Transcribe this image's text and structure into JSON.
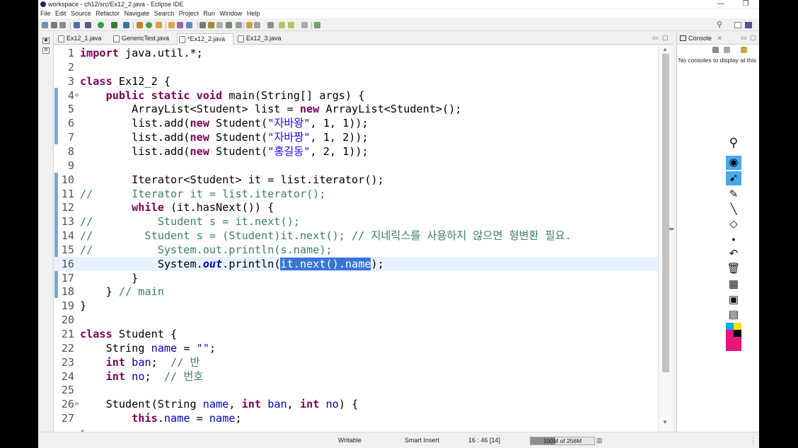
{
  "window": {
    "title": "workspace - ch12/src/Ex12_2.java - Eclipse IDE",
    "controls": [
      "—",
      "❐",
      "✕"
    ]
  },
  "menu": [
    "File",
    "Edit",
    "Source",
    "Refactor",
    "Navigate",
    "Search",
    "Project",
    "Run",
    "Window",
    "Help"
  ],
  "editor_tabs": [
    {
      "label": "Ex12_1.java",
      "active": false
    },
    {
      "label": "GenericTest.java",
      "active": false
    },
    {
      "label": "*Ex12_2.java",
      "active": true
    },
    {
      "label": "Ex12_3.java",
      "active": false
    }
  ],
  "tab_close": "✕",
  "editor_controls": {
    "minimize": "▭",
    "maximize": "▢"
  },
  "code_lines": [
    {
      "n": "1",
      "tokens": [
        [
          "kw",
          "import"
        ],
        [
          "",
          " java.util.*;"
        ]
      ]
    },
    {
      "n": "2",
      "tokens": []
    },
    {
      "n": "3",
      "tokens": [
        [
          "kw",
          "class"
        ],
        [
          "",
          " Ex12_2 {"
        ]
      ]
    },
    {
      "n": "4",
      "fold": "⊖",
      "tokens": [
        [
          "",
          "    "
        ],
        [
          "kw",
          "public static void"
        ],
        [
          "",
          " main(String[] args) {"
        ]
      ]
    },
    {
      "n": "5",
      "tokens": [
        [
          "",
          "        ArrayList<Student> list = "
        ],
        [
          "kw",
          "new"
        ],
        [
          "",
          " ArrayList<Student>();"
        ]
      ]
    },
    {
      "n": "6",
      "tokens": [
        [
          "",
          "        list.add("
        ],
        [
          "kw",
          "new"
        ],
        [
          "",
          " Student("
        ],
        [
          "str",
          "\"자바왕\""
        ],
        [
          "",
          ", 1, 1));"
        ]
      ]
    },
    {
      "n": "7",
      "tokens": [
        [
          "",
          "        list.add("
        ],
        [
          "kw",
          "new"
        ],
        [
          "",
          " Student("
        ],
        [
          "str",
          "\"자바짱\""
        ],
        [
          "",
          ", 1, 2));"
        ]
      ]
    },
    {
      "n": "8",
      "tokens": [
        [
          "",
          "        list.add("
        ],
        [
          "kw",
          "new"
        ],
        [
          "",
          " Student("
        ],
        [
          "str",
          "\"홍길동\""
        ],
        [
          "",
          ", 2, 1));"
        ]
      ]
    },
    {
      "n": "9",
      "tokens": []
    },
    {
      "n": "10",
      "tokens": [
        [
          "",
          "        Iterator<Student> it = list.iterator();"
        ]
      ]
    },
    {
      "n": "11",
      "tokens": [
        [
          "cmt",
          "//      Iterator it = list.iterator();"
        ]
      ]
    },
    {
      "n": "12",
      "tokens": [
        [
          "",
          "        "
        ],
        [
          "kw",
          "while"
        ],
        [
          "",
          " (it.hasNext()) {"
        ]
      ]
    },
    {
      "n": "13",
      "tokens": [
        [
          "cmt",
          "//          Student s = it.next();"
        ]
      ]
    },
    {
      "n": "14",
      "tokens": [
        [
          "cmt",
          "//        Student s = (Student)it.next(); // 지네릭스를 사용하지 않으면 형변환 필요."
        ]
      ]
    },
    {
      "n": "15",
      "tokens": [
        [
          "cmt",
          "//          System.out.println(s.name);"
        ]
      ]
    },
    {
      "n": "16",
      "current": true,
      "tokens": [
        [
          "",
          "            System."
        ],
        [
          "sfld",
          "out"
        ],
        [
          "",
          ".println("
        ],
        [
          "sel",
          "it.next().name"
        ],
        [
          "",
          ");"
        ]
      ]
    },
    {
      "n": "17",
      "tokens": [
        [
          "",
          "        }"
        ]
      ]
    },
    {
      "n": "18",
      "tokens": [
        [
          "",
          "    } "
        ],
        [
          "cmt",
          "// main"
        ]
      ]
    },
    {
      "n": "19",
      "tokens": [
        [
          "",
          "}"
        ]
      ]
    },
    {
      "n": "20",
      "tokens": []
    },
    {
      "n": "21",
      "tokens": [
        [
          "kw",
          "class"
        ],
        [
          "",
          " Student {"
        ]
      ]
    },
    {
      "n": "22",
      "tokens": [
        [
          "",
          "    String "
        ],
        [
          "fld",
          "name"
        ],
        [
          "",
          " = "
        ],
        [
          "str",
          "\"\""
        ],
        [
          "",
          ";"
        ]
      ]
    },
    {
      "n": "23",
      "tokens": [
        [
          "",
          "    "
        ],
        [
          "kw",
          "int"
        ],
        [
          "",
          " "
        ],
        [
          "fld",
          "ban"
        ],
        [
          "",
          ";  "
        ],
        [
          "cmt",
          "// 반"
        ]
      ]
    },
    {
      "n": "24",
      "tokens": [
        [
          "",
          "    "
        ],
        [
          "kw",
          "int"
        ],
        [
          "",
          " "
        ],
        [
          "fld",
          "no"
        ],
        [
          "",
          ";  "
        ],
        [
          "cmt",
          "// 번호"
        ]
      ]
    },
    {
      "n": "25",
      "tokens": []
    },
    {
      "n": "26",
      "fold": "⊖",
      "tokens": [
        [
          "",
          "    Student(String "
        ],
        [
          "fld",
          "name"
        ],
        [
          "",
          ", "
        ],
        [
          "kw",
          "int"
        ],
        [
          "",
          " "
        ],
        [
          "fld",
          "ban"
        ],
        [
          "",
          ", "
        ],
        [
          "kw",
          "int"
        ],
        [
          "",
          " "
        ],
        [
          "fld",
          "no"
        ],
        [
          "",
          ") {"
        ]
      ]
    },
    {
      "n": "27",
      "tokens": [
        [
          "",
          "        "
        ],
        [
          "kw",
          "this"
        ],
        [
          "",
          "."
        ],
        [
          "fld",
          "name"
        ],
        [
          "",
          " = "
        ],
        [
          "fld",
          "name"
        ],
        [
          "",
          ";"
        ]
      ]
    }
  ],
  "console": {
    "tab_label": "Console",
    "message": "No consoles to display at this"
  },
  "status": {
    "writable": "Writable",
    "insert_mode": "Smart Insert",
    "position": "16 : 46 [14]",
    "memory": "100M of 256M",
    "memory_used_fraction": 0.39
  },
  "colors": {
    "keyword": "#7f0055",
    "string": "#2a00ff",
    "comment": "#3f7f5f",
    "field": "#0000c0",
    "selection": "#3875d7",
    "current_line": "#e8f2fe"
  },
  "annotation_tools": [
    "pin-icon",
    "eye-icon",
    "pointer-icon",
    "highlighter-icon",
    "pen-icon",
    "eraser-icon",
    "dot-icon",
    "undo-icon",
    "trash-icon",
    "board-icon",
    "camera-icon",
    "clipboard-icon"
  ]
}
